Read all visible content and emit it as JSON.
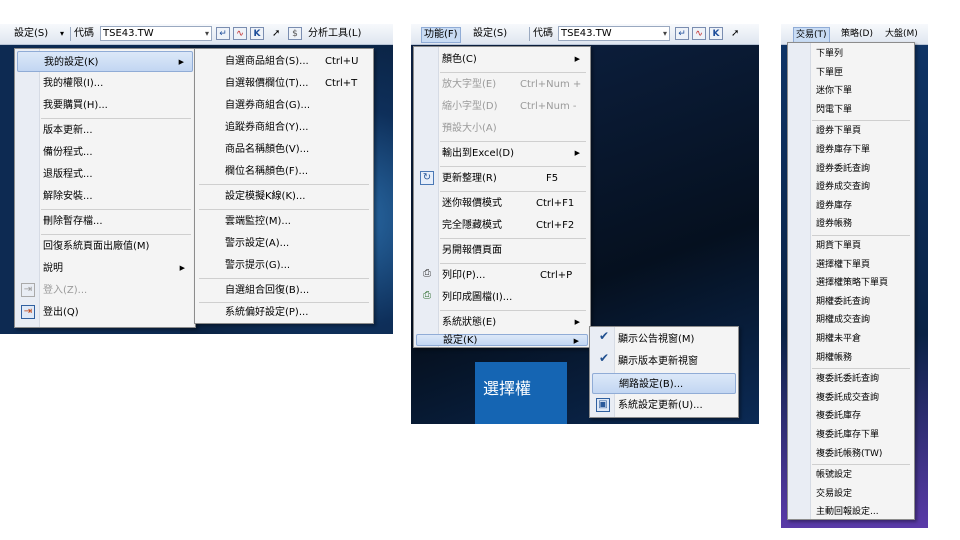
{
  "panel1": {
    "toolbar": {
      "settings_menu": "設定(S)",
      "code_label": "代碼",
      "code_value": "TSE43.TW",
      "analysis_tools": "分析工具(L)"
    },
    "menu": [
      {
        "label": "我的設定(K)",
        "submenu": true,
        "highlighted": true
      },
      {
        "label": "我的權限(I)..."
      },
      {
        "label": "我要購買(H)..."
      },
      {
        "label": "版本更新..."
      },
      {
        "label": "備份程式..."
      },
      {
        "label": "退版程式..."
      },
      {
        "label": "解除安裝..."
      },
      {
        "label": "刪除暫存檔..."
      },
      {
        "label": "回復系統頁面出廠值(M)"
      },
      {
        "label": "說明",
        "submenu": true
      },
      {
        "label": "登入(Z)...",
        "disabled": true
      },
      {
        "label": "登出(Q)"
      }
    ],
    "submenu": [
      {
        "label": "自選商品組合(S)...",
        "shortcut": "Ctrl+U"
      },
      {
        "label": "自選報價欄位(T)...",
        "shortcut": "Ctrl+T"
      },
      {
        "label": "自選券商組合(G)..."
      },
      {
        "label": "追蹤券商組合(Y)..."
      },
      {
        "label": "商品名稱顏色(V)..."
      },
      {
        "label": "欄位名稱顏色(F)..."
      },
      {
        "label": "設定模擬K線(K)..."
      },
      {
        "label": "雲端監控(M)..."
      },
      {
        "label": "警示設定(A)..."
      },
      {
        "label": "警示提示(G)..."
      },
      {
        "label": "自選組合回復(B)..."
      },
      {
        "label": "系統偏好設定(P)..."
      }
    ]
  },
  "panel2": {
    "toolbar": {
      "function_menu": "功能(F)",
      "settings_menu": "設定(S)",
      "code_label": "代碼",
      "code_value": "TSE43.TW"
    },
    "menu": [
      {
        "label": "顏色(C)",
        "submenu": true
      },
      {
        "label": "放大字型(E)",
        "shortcut": "Ctrl+Num +",
        "disabled": true
      },
      {
        "label": "縮小字型(D)",
        "shortcut": "Ctrl+Num -",
        "disabled": true
      },
      {
        "label": "預設大小(A)",
        "disabled": true
      },
      {
        "label": "輸出到Excel(D)",
        "submenu": true
      },
      {
        "label": "更新整理(R)",
        "shortcut": "F5"
      },
      {
        "label": "迷你報價模式",
        "shortcut": "Ctrl+F1"
      },
      {
        "label": "完全隱藏模式",
        "shortcut": "Ctrl+F2"
      },
      {
        "label": "另開報價頁面"
      },
      {
        "label": "列印(P)...",
        "shortcut": "Ctrl+P"
      },
      {
        "label": "列印成圖檔(I)..."
      },
      {
        "label": "系統狀態(E)",
        "submenu": true
      },
      {
        "label": "設定(K)",
        "submenu": true,
        "highlighted": true
      }
    ],
    "submenu": [
      {
        "label": "顯示公告視窗(M)",
        "checked": true
      },
      {
        "label": "顯示版本更新視窗",
        "checked": true
      },
      {
        "label": "網路設定(B)...",
        "highlighted": true
      },
      {
        "label": "系統設定更新(U)..."
      }
    ],
    "bg_text": "選擇權"
  },
  "panel3": {
    "toolbar": {
      "trade_menu": "交易(T)",
      "strategy_menu": "策略(D)",
      "market_menu": "大盤(M)"
    },
    "menu": [
      {
        "label": "下單列"
      },
      {
        "label": "下單匣"
      },
      {
        "label": "迷你下單"
      },
      {
        "label": "閃電下單"
      },
      {
        "label": "證券下單頁",
        "sep_before": true
      },
      {
        "label": "證券庫存下單"
      },
      {
        "label": "證券委託查詢"
      },
      {
        "label": "證券成交查詢"
      },
      {
        "label": "證券庫存"
      },
      {
        "label": "證券帳務"
      },
      {
        "label": "期貨下單頁",
        "sep_before": true
      },
      {
        "label": "選擇權下單頁"
      },
      {
        "label": "選擇權策略下單頁"
      },
      {
        "label": "期權委託查詢"
      },
      {
        "label": "期權成交查詢"
      },
      {
        "label": "期權未平倉"
      },
      {
        "label": "期權帳務"
      },
      {
        "label": "複委託委託查詢",
        "sep_before": true
      },
      {
        "label": "複委託成交查詢"
      },
      {
        "label": "複委託庫存"
      },
      {
        "label": "複委託庫存下單"
      },
      {
        "label": "複委託帳務(TW)"
      },
      {
        "label": "帳號設定",
        "sep_before": true
      },
      {
        "label": "交易設定"
      },
      {
        "label": "主動回報設定..."
      }
    ]
  },
  "colors": {
    "highlight": "#c9dcf4",
    "menu_bg": "#f4f4f4",
    "app_dark": "#0b1a33",
    "accent_blue": "#1464b4"
  }
}
